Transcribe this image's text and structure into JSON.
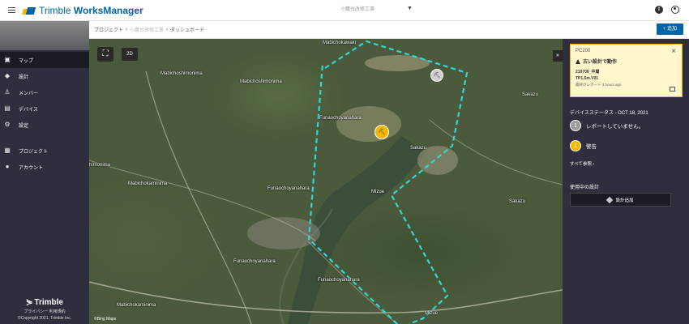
{
  "header": {
    "brand": "Trimble",
    "app_name": "WorksManager",
    "project_name": "小鷹台改修工事",
    "info_icon": "info-icon",
    "user_icon": "user-icon"
  },
  "sidebar": {
    "items": [
      {
        "label": "マップ",
        "icon": "map-icon"
      },
      {
        "label": "設計",
        "icon": "cube-icon"
      },
      {
        "label": "メンバー",
        "icon": "person-icon"
      },
      {
        "label": "デバイス",
        "icon": "device-icon"
      },
      {
        "label": "設定",
        "icon": "gear-icon"
      }
    ],
    "items2": [
      {
        "label": "プロジェクト",
        "icon": "building-icon"
      },
      {
        "label": "アカウント",
        "icon": "account-icon"
      }
    ],
    "footer": {
      "brand": "Trimble",
      "links": "プライバシー 利用規約",
      "copyright": "©Copyright 2021, Trimble Inc."
    }
  },
  "breadcrumb": {
    "root": "プロジェクト",
    "project": "小鷹台改修工事",
    "current": "ダッシュボード"
  },
  "actions": {
    "add_label": "+ 追加"
  },
  "map": {
    "view_label": "2D",
    "expand_label": "»",
    "attribution": "©Bing Maps",
    "labels": [
      "Mabichokawaki",
      "Mabichoshimonima",
      "Mabichoshimonima",
      "Sakazu",
      "Funaochoyanahara",
      "Sakazu",
      "Mizue",
      "Sakazu",
      "Mabichokaminima",
      "Funaochoyanahara",
      "Funaochoyanahara",
      "Funaochoyanahara",
      "Mabichokaminima",
      "Mizue",
      "himonima"
    ]
  },
  "panel": {
    "alert": {
      "device": "PC200",
      "status": "古い設計で動作",
      "line1": "210706_中層",
      "line2": "TP1.5m.V01",
      "line3": "最終のレポート 3 hours ago"
    },
    "device_status_title": "デバイスステータス - OCT 18, 2021",
    "status_items": [
      {
        "count": "1",
        "label": "レポートしていません。",
        "color": "#9a9a9a"
      },
      {
        "count": "1",
        "label": "警告",
        "color": "#f5b800"
      }
    ],
    "see_all": "すべて参照 ›",
    "designs_title": "使用中の設計",
    "add_design_label": "設計追加"
  },
  "colors": {
    "brand_blue": "#0063a3",
    "brand_yellow": "#f5b800",
    "sidebar_bg": "#2e2e3c",
    "boundary": "#33d6d6"
  }
}
